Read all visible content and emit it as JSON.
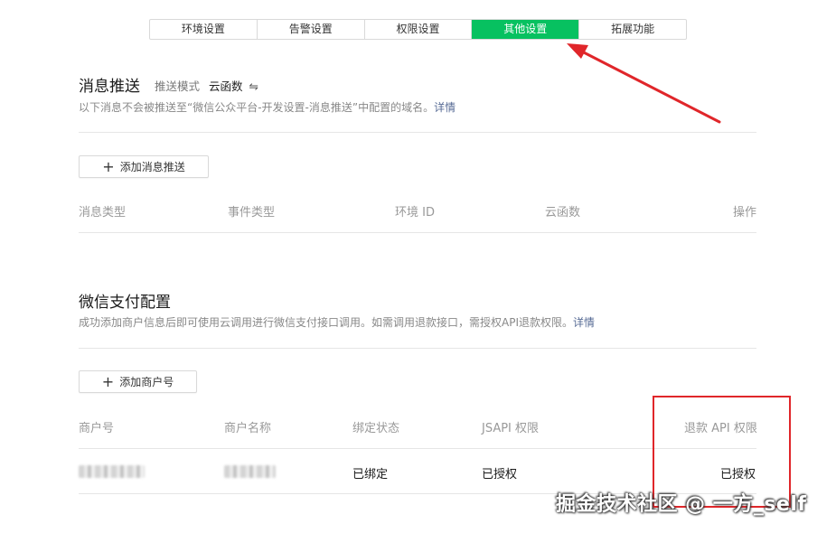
{
  "tabs": [
    {
      "label": "环境设置"
    },
    {
      "label": "告警设置"
    },
    {
      "label": "权限设置"
    },
    {
      "label": "其他设置",
      "active": true
    },
    {
      "label": "拓展功能"
    }
  ],
  "message_push": {
    "title": "消息推送",
    "mode_label": "推送模式",
    "mode_value": "云函数",
    "switch_icon": "⇋",
    "desc": "以下消息不会被推送至“微信公众平台-开发设置-消息推送”中配置的域名。",
    "detail_link": "详情",
    "add_button": "添加消息推送",
    "columns": [
      "消息类型",
      "事件类型",
      "环境 ID",
      "云函数",
      "操作"
    ]
  },
  "wechat_pay": {
    "title": "微信支付配置",
    "desc": "成功添加商户信息后即可使用云调用进行微信支付接口调用。如需调用退款接口，需授权API退款权限。",
    "detail_link": "详情",
    "add_button": "添加商户号",
    "columns": [
      "商户号",
      "商户名称",
      "绑定状态",
      "JSAPI 权限",
      "退款 API 权限"
    ],
    "rows": [
      {
        "bind_status": "已绑定",
        "jsapi": "已授权",
        "refund_api": "已授权"
      }
    ]
  },
  "watermark": "掘金技术社区 @ 一方_self",
  "colors": {
    "accent": "#07c160",
    "link": "#576b95",
    "annotation": "#e0262a"
  }
}
